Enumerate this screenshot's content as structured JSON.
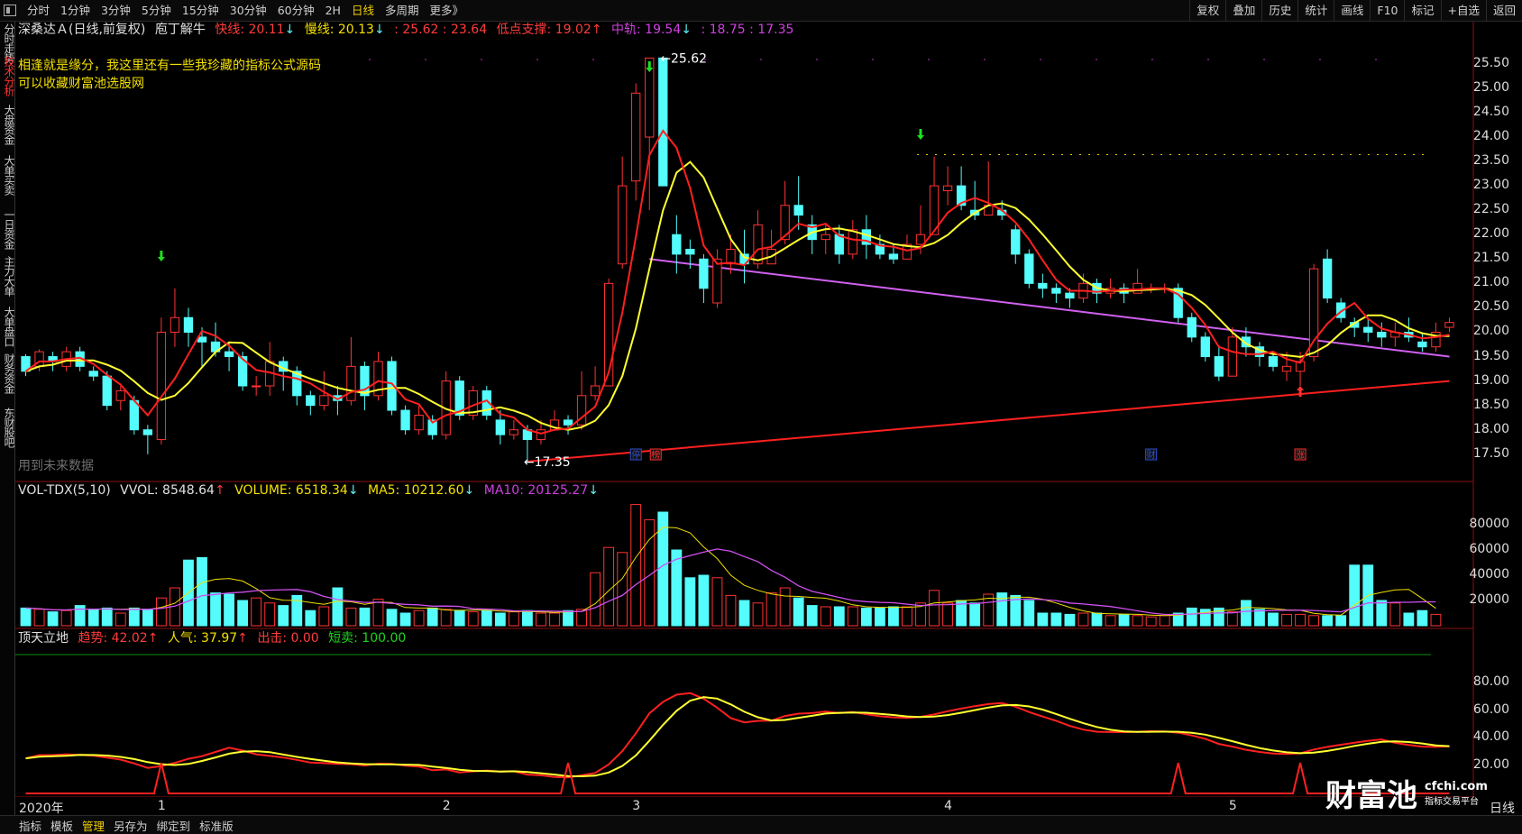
{
  "toolbar": {
    "left": [
      "分时",
      "1分钟",
      "3分钟",
      "5分钟",
      "15分钟",
      "30分钟",
      "60分钟",
      "2H",
      "日线",
      "多周期",
      "更多》"
    ],
    "active": "日线",
    "right": [
      "复权",
      "叠加",
      "历史",
      "统计",
      "画线",
      "F10",
      "标记",
      "+自选",
      "返回"
    ]
  },
  "left_tabs": [
    "分时走势",
    "技术分析",
    "大盘资金",
    "大单买卖",
    "一日资金",
    "主力大单",
    "大单盘口",
    "财务资金",
    "东财股吧"
  ],
  "left_tabs_active": "技术分析",
  "main_header": {
    "stock": "深桑达Ａ(日线,前复权)",
    "indicator": "庖丁解牛",
    "fast_label": "快线: 20.11",
    "slow_label": "慢线: 20.13",
    "range": ": 25.62 : 23.64",
    "low_support": "低点支撑: 19.02",
    "mid": "中轨: 19.54",
    "extra": ": 18.75 : 17.35"
  },
  "annotation_lines": [
    "相逢就是缘分，我这里还有一些我珍藏的指标公式源码",
    "可以收藏财富池选股网"
  ],
  "future_note": "用到未来数据",
  "high_label": "25.62",
  "low_label": "17.35",
  "markers": [
    {
      "text": "停",
      "color": "#3050d0"
    },
    {
      "text": "榜",
      "color": "#ff3030"
    },
    {
      "text": "财",
      "color": "#3050d0"
    },
    {
      "text": "涨",
      "color": "#ff3030"
    }
  ],
  "price_axis": [
    "25.50",
    "25.00",
    "24.50",
    "24.00",
    "23.50",
    "23.00",
    "22.50",
    "22.00",
    "21.50",
    "21.00",
    "20.50",
    "20.00",
    "19.50",
    "19.00",
    "18.50",
    "18.00",
    "17.50"
  ],
  "vol_header": {
    "name": "VOL-TDX(5,10)",
    "vvol": "VVOL: 8548.64",
    "volume": "VOLUME: 6518.34",
    "ma5": "MA5: 10212.60",
    "ma10": "MA10: 20125.27"
  },
  "vol_axis": [
    "80000",
    "60000",
    "40000",
    "20000"
  ],
  "ind_header": {
    "name": "顶天立地",
    "trend": "趋势: 42.02",
    "pop": "人气: 37.97",
    "exit": "出击: 0.00",
    "short": "短卖: 100.00"
  },
  "ind_axis": [
    "80.00",
    "60.00",
    "40.00",
    "20.00"
  ],
  "x_labels": [
    "2020年",
    "1",
    "2",
    "3",
    "4",
    "5"
  ],
  "period": "日线",
  "bottom_bar": [
    "指标",
    "模板",
    "管理",
    "另存为",
    "绑定到",
    "标准版"
  ],
  "bottom_active": "管理",
  "watermark": {
    "main": "财富池",
    "url": "cfchi.com",
    "sub": "指标交易平台"
  },
  "colors": {
    "up": "#ff3232",
    "down": "#54fcfc",
    "fast": "#ff2020",
    "slow": "#ffff30",
    "mid": "#d060f0",
    "support": "#ff2020"
  },
  "chart_data": {
    "type": "candlestick",
    "ylim": [
      17.2,
      25.7
    ],
    "candles": [
      [
        19.5,
        19.2,
        19.55,
        19.1
      ],
      [
        19.3,
        19.6,
        19.65,
        19.2
      ],
      [
        19.5,
        19.4,
        19.6,
        19.2
      ],
      [
        19.3,
        19.6,
        19.7,
        19.2
      ],
      [
        19.6,
        19.3,
        19.7,
        19.2
      ],
      [
        19.2,
        19.1,
        19.3,
        19.0
      ],
      [
        19.1,
        18.5,
        19.2,
        18.4
      ],
      [
        18.6,
        18.8,
        18.9,
        18.4
      ],
      [
        18.6,
        18.0,
        18.7,
        17.9
      ],
      [
        18.0,
        17.9,
        18.1,
        17.5
      ],
      [
        17.8,
        20.0,
        20.3,
        17.7
      ],
      [
        20.0,
        20.3,
        20.9,
        19.7
      ],
      [
        20.3,
        20.0,
        20.5,
        19.7
      ],
      [
        19.9,
        19.8,
        20.1,
        19.3
      ],
      [
        19.8,
        19.6,
        20.2,
        19.5
      ],
      [
        19.6,
        19.5,
        19.8,
        19.2
      ],
      [
        19.5,
        18.9,
        19.6,
        18.8
      ],
      [
        18.9,
        18.9,
        19.1,
        18.7
      ],
      [
        18.9,
        19.4,
        19.8,
        18.7
      ],
      [
        19.4,
        19.2,
        19.5,
        18.8
      ],
      [
        19.2,
        18.7,
        19.3,
        18.5
      ],
      [
        18.7,
        18.5,
        18.8,
        18.3
      ],
      [
        18.5,
        18.7,
        19.2,
        18.4
      ],
      [
        18.7,
        18.6,
        18.9,
        18.3
      ],
      [
        18.6,
        19.3,
        19.9,
        18.5
      ],
      [
        19.3,
        18.7,
        19.4,
        18.4
      ],
      [
        18.7,
        19.4,
        19.6,
        18.6
      ],
      [
        19.4,
        18.4,
        19.5,
        18.3
      ],
      [
        18.4,
        18.0,
        18.5,
        17.9
      ],
      [
        18.0,
        18.3,
        18.5,
        17.9
      ],
      [
        18.2,
        17.9,
        18.3,
        17.8
      ],
      [
        17.9,
        19.0,
        19.2,
        17.8
      ],
      [
        19.0,
        18.3,
        19.1,
        18.2
      ],
      [
        18.3,
        18.8,
        18.9,
        18.2
      ],
      [
        18.8,
        18.3,
        18.9,
        18.2
      ],
      [
        18.2,
        17.9,
        18.4,
        17.7
      ],
      [
        17.9,
        18.0,
        18.2,
        17.8
      ],
      [
        18.0,
        17.8,
        18.1,
        17.35
      ],
      [
        17.8,
        18.0,
        18.2,
        17.7
      ],
      [
        18.0,
        18.2,
        18.4,
        18.0
      ],
      [
        18.2,
        18.1,
        18.3,
        17.9
      ],
      [
        18.1,
        18.7,
        19.2,
        18.0
      ],
      [
        18.7,
        18.9,
        19.3,
        18.6
      ],
      [
        18.9,
        21.0,
        21.1,
        18.9
      ],
      [
        21.4,
        23.0,
        23.6,
        21.3
      ],
      [
        23.1,
        24.9,
        25.1,
        22.7
      ],
      [
        24.0,
        25.62,
        25.62,
        22.5
      ],
      [
        25.62,
        23.0,
        25.62,
        23.0
      ],
      [
        22.0,
        21.6,
        22.4,
        21.2
      ],
      [
        21.7,
        21.6,
        21.9,
        21.3
      ],
      [
        21.5,
        20.9,
        21.6,
        20.6
      ],
      [
        20.6,
        21.5,
        21.7,
        20.5
      ],
      [
        21.4,
        21.7,
        22.0,
        21.2
      ],
      [
        21.6,
        21.4,
        22.1,
        21.0
      ],
      [
        21.4,
        22.2,
        22.5,
        21.3
      ],
      [
        21.4,
        21.7,
        22.1,
        21.4
      ],
      [
        21.9,
        22.6,
        23.1,
        21.8
      ],
      [
        22.6,
        22.4,
        23.2,
        22.1
      ],
      [
        22.2,
        21.9,
        22.4,
        21.6
      ],
      [
        21.9,
        22.0,
        22.2,
        21.6
      ],
      [
        22.0,
        21.6,
        22.2,
        21.4
      ],
      [
        21.6,
        22.1,
        22.3,
        21.5
      ],
      [
        22.1,
        21.8,
        22.4,
        21.5
      ],
      [
        21.8,
        21.6,
        22.0,
        21.5
      ],
      [
        21.6,
        21.5,
        21.8,
        21.4
      ],
      [
        21.5,
        21.8,
        22.0,
        21.5
      ],
      [
        21.8,
        22.0,
        22.6,
        21.6
      ],
      [
        22.0,
        23.0,
        23.6,
        22.0
      ],
      [
        22.9,
        23.0,
        23.4,
        22.6
      ],
      [
        23.0,
        22.6,
        23.4,
        22.5
      ],
      [
        22.5,
        22.4,
        23.1,
        22.3
      ],
      [
        22.4,
        22.6,
        23.5,
        22.4
      ],
      [
        22.5,
        22.4,
        22.7,
        22.3
      ],
      [
        22.1,
        21.6,
        22.2,
        21.4
      ],
      [
        21.6,
        21.0,
        21.7,
        20.9
      ],
      [
        21.0,
        20.9,
        21.2,
        20.7
      ],
      [
        20.9,
        20.8,
        21.0,
        20.6
      ],
      [
        20.8,
        20.7,
        20.9,
        20.5
      ],
      [
        20.7,
        21.0,
        21.2,
        20.6
      ],
      [
        21.0,
        20.8,
        21.1,
        20.6
      ],
      [
        20.8,
        20.9,
        21.1,
        20.7
      ],
      [
        20.9,
        20.8,
        21.0,
        20.6
      ],
      [
        20.8,
        21.0,
        21.3,
        20.8
      ],
      [
        20.9,
        20.9,
        21.0,
        20.8
      ],
      [
        20.9,
        20.9,
        21.0,
        20.8
      ],
      [
        20.9,
        20.3,
        21.0,
        20.2
      ],
      [
        20.3,
        19.9,
        20.4,
        19.8
      ],
      [
        19.9,
        19.5,
        20.0,
        19.4
      ],
      [
        19.5,
        19.1,
        19.7,
        19.0
      ],
      [
        19.1,
        19.9,
        20.1,
        19.1
      ],
      [
        19.9,
        19.7,
        20.1,
        19.5
      ],
      [
        19.7,
        19.5,
        19.8,
        19.3
      ],
      [
        19.5,
        19.3,
        19.6,
        19.2
      ],
      [
        19.2,
        19.3,
        19.6,
        19.0
      ],
      [
        19.2,
        19.4,
        19.6,
        18.9
      ],
      [
        19.5,
        21.3,
        21.4,
        19.4
      ],
      [
        21.5,
        20.7,
        21.7,
        20.6
      ],
      [
        20.6,
        20.3,
        20.7,
        20.2
      ],
      [
        20.2,
        20.1,
        20.3,
        19.9
      ],
      [
        20.1,
        20.0,
        20.3,
        19.8
      ],
      [
        20.0,
        19.9,
        20.2,
        19.7
      ],
      [
        19.9,
        20.0,
        20.2,
        19.7
      ],
      [
        20.0,
        19.9,
        20.3,
        19.8
      ],
      [
        19.8,
        19.7,
        20.0,
        19.6
      ],
      [
        19.7,
        20.0,
        20.2,
        19.6
      ],
      [
        20.1,
        20.2,
        20.3,
        20.0
      ]
    ],
    "volume": [
      14000,
      13000,
      11000,
      12000,
      16000,
      13000,
      14000,
      10000,
      14000,
      13000,
      22000,
      30000,
      52000,
      54000,
      26000,
      25000,
      20000,
      22000,
      18000,
      16000,
      24000,
      12000,
      15000,
      30000,
      14000,
      14000,
      21000,
      13000,
      10000,
      12000,
      14000,
      13000,
      12000,
      11000,
      12000,
      10000,
      11000,
      12000,
      10000,
      10000,
      12000,
      13000,
      42000,
      62000,
      58000,
      96000,
      84000,
      90000,
      60000,
      38000,
      40000,
      38000,
      24000,
      20000,
      18000,
      26000,
      30000,
      22000,
      16000,
      15000,
      15000,
      15000,
      14000,
      14000,
      15000,
      15000,
      18000,
      28000,
      18000,
      20000,
      18000,
      25000,
      26000,
      24000,
      20000,
      10000,
      10000,
      9000,
      10000,
      10000,
      8000,
      9000,
      8000,
      7000,
      8000,
      10000,
      14000,
      13000,
      14000,
      11000,
      20000,
      13000,
      10000,
      9000,
      9000,
      8000,
      8000,
      8000,
      48000,
      48000,
      20000,
      18000,
      10000,
      12000,
      9000
    ],
    "vol_axis_max": 100000,
    "indicator_ylim": [
      0,
      100
    ]
  }
}
